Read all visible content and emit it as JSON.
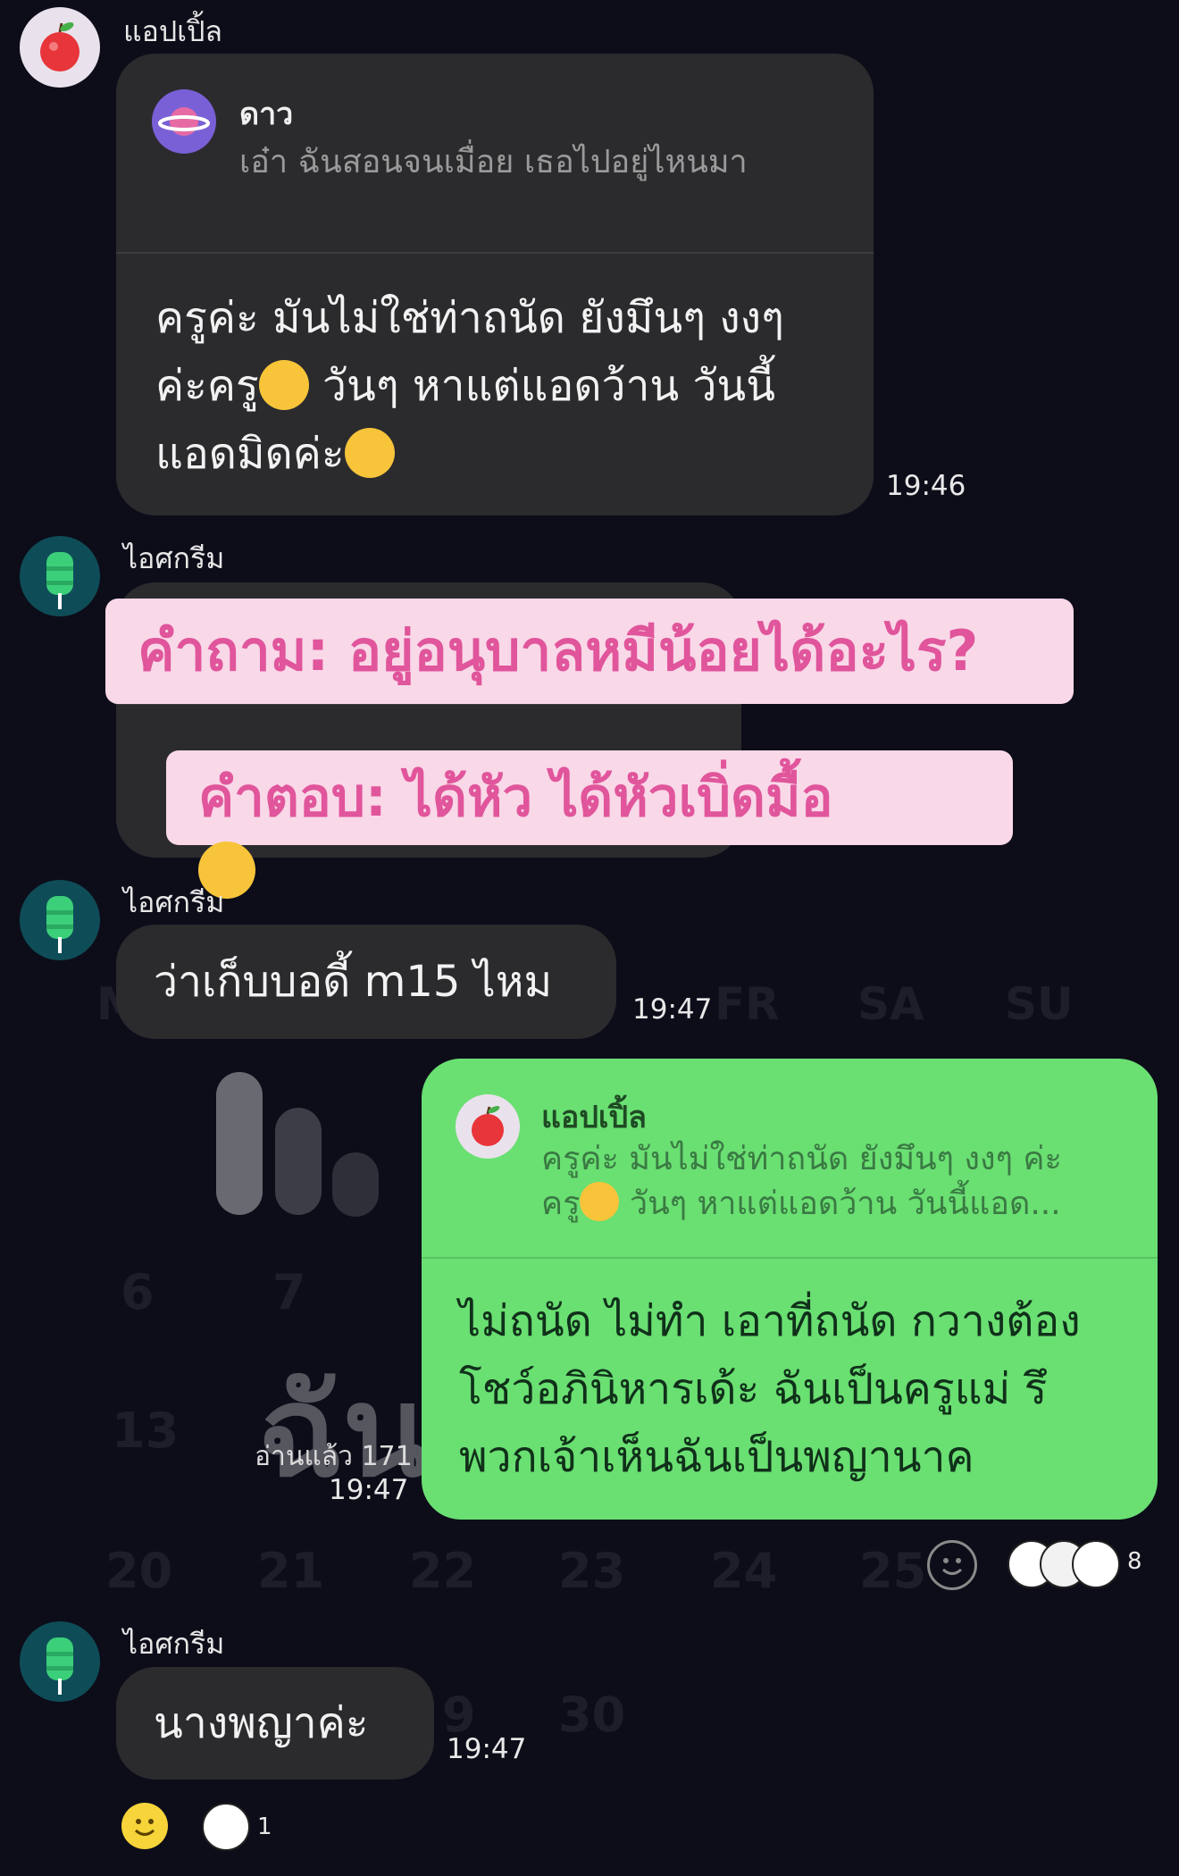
{
  "background_watermark": {
    "weekdays": [
      "M",
      "FR",
      "SA",
      "SU"
    ],
    "dates": [
      "6",
      "7",
      "13",
      "20",
      "21",
      "22",
      "23",
      "24",
      "25",
      "9",
      "30"
    ],
    "big_text": "ฉัน"
  },
  "messages": [
    {
      "sender": "แอปเปิ้ล",
      "avatar_icon": "apple-icon",
      "quote_sender": "ดาว",
      "quote_text": "เอ๋า ฉันสอนจนเมื่อย เธอไปอยู่ไหนมา",
      "lines": [
        "ครูค่ะ มันไม่ใช่ท่าถนัด ยังมึนๆ งงๆ",
        "ค่ะครู",
        "วันๆ หาแต่แอดว้าน วันนี้",
        "แอดมิดค่ะ"
      ],
      "time": "19:46"
    },
    {
      "sender": "ไอศกรีม",
      "avatar_icon": "ice-cream-icon",
      "time": ""
    },
    {
      "sender": "ไอศกรีม",
      "avatar_icon": "ice-cream-icon",
      "text": "ว่าเก็บบอดี้ m15 ไหม",
      "time": "19:47"
    },
    {
      "sender": "me",
      "quote_sender": "แอปเปิ้ล",
      "quote_line1": "ครูค่ะ มันไม่ใช่ท่าถนัด ยังมึนๆ งงๆ ค่ะ",
      "quote_line2_a": "ครู",
      "quote_line2_b": " วันๆ หาแต่แอดว้าน วันนี้แอด...",
      "lines": [
        "ไม่ถนัด ไม่ทำ เอาที่ถนัด กวางต้อง",
        "โชว์อภินิหารเด้ะ ฉันเป็นครูแม่  รึ",
        "พวกเจ้าเห็นฉันเป็นพญานาค"
      ],
      "read_status": "อ่านแล้ว 171",
      "time": "19:47",
      "reaction_count": "8"
    },
    {
      "sender": "ไอศกรีม",
      "avatar_icon": "ice-cream-icon",
      "text": "นางพญาค่ะ",
      "time": "19:47",
      "reaction_count": "1"
    }
  ],
  "overlay": {
    "question": "คำถาม: อยู่อนุบาลหมีน้อยได้อะไร?",
    "answer": "คำตอบ: ได้หัว ได้หัวเบิ่ดมื้อ"
  },
  "colors": {
    "background": "#0d0d1a",
    "incoming_bubble": "#2b2b2e",
    "outgoing_bubble": "#6adf72",
    "overlay_bg": "#f9d8e8",
    "overlay_text": "#e0559b"
  }
}
